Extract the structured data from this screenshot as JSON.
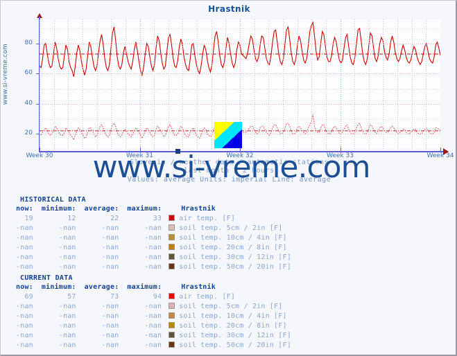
{
  "chart_data": {
    "type": "line",
    "title": "Hrastnik",
    "xlabel": "",
    "ylabel": "",
    "ylim": [
      10,
      96
    ],
    "yticks": [
      20,
      40,
      60,
      80
    ],
    "xticks": [
      "Week 30",
      "Week 31",
      "Week 32",
      "Week 33",
      "Week 34"
    ],
    "grid": true,
    "legend_position": "below-table",
    "subtitle_line1": "Slovenia / weather data / automatic stations",
    "subtitle_line2": "last month / 2 hours",
    "subtitle_line3": "Values: average  Units: imperial  Line: average",
    "watermark": "www.si-vreme.com",
    "side_label": "www.si-vreme.com",
    "series": [
      {
        "name": "air temp. [F] - current",
        "color": "#cc0000",
        "style": "solid",
        "average_line": 73,
        "min": 57,
        "max": 94,
        "now": 69,
        "values": [
          65,
          64,
          70,
          79,
          80,
          73,
          67,
          64,
          65,
          73,
          81,
          77,
          70,
          65,
          63,
          64,
          72,
          79,
          76,
          68,
          64,
          62,
          58,
          65,
          74,
          79,
          75,
          68,
          63,
          59,
          63,
          72,
          81,
          78,
          71,
          65,
          62,
          65,
          74,
          82,
          86,
          79,
          70,
          64,
          62,
          66,
          77,
          87,
          91,
          82,
          71,
          65,
          63,
          66,
          74,
          78,
          73,
          68,
          65,
          63,
          68,
          76,
          81,
          75,
          68,
          62,
          59,
          64,
          73,
          80,
          78,
          71,
          65,
          62,
          66,
          77,
          85,
          82,
          74,
          67,
          63,
          65,
          75,
          84,
          86,
          79,
          70,
          65,
          64,
          69,
          78,
          83,
          79,
          71,
          66,
          63,
          62,
          70,
          79,
          80,
          72,
          66,
          62,
          60,
          65,
          73,
          79,
          76,
          69,
          64,
          61,
          66,
          76,
          85,
          88,
          81,
          72,
          66,
          64,
          68,
          77,
          84,
          80,
          73,
          67,
          64,
          67,
          76,
          81,
          79,
          73,
          72,
          71,
          70,
          74,
          80,
          85,
          83,
          76,
          70,
          68,
          71,
          79,
          85,
          84,
          77,
          70,
          67,
          66,
          72,
          81,
          88,
          89,
          81,
          73,
          68,
          66,
          70,
          80,
          89,
          91,
          83,
          74,
          68,
          66,
          70,
          79,
          85,
          82,
          75,
          69,
          67,
          70,
          79,
          88,
          92,
          94,
          85,
          75,
          69,
          71,
          80,
          88,
          86,
          78,
          71,
          68,
          68,
          72,
          80,
          84,
          81,
          74,
          69,
          67,
          69,
          77,
          84,
          86,
          78,
          71,
          67,
          66,
          71,
          80,
          89,
          90,
          82,
          73,
          68,
          66,
          70,
          79,
          87,
          85,
          77,
          70,
          68,
          72,
          80,
          84,
          82,
          75,
          71,
          69,
          73,
          81,
          85,
          81,
          74,
          70,
          68,
          70,
          75,
          79,
          76,
          71,
          68,
          67,
          69,
          74,
          78,
          76,
          71,
          68,
          66,
          68,
          73,
          78,
          80,
          75,
          70,
          68,
          67,
          71,
          79,
          81,
          77,
          72
        ]
      },
      {
        "name": "air temp. [F] - historical",
        "color": "#e06666",
        "style": "dotted",
        "average_line": 22,
        "min": 12,
        "max": 33,
        "now": 19,
        "values": [
          20,
          19,
          21,
          23,
          24,
          22,
          20,
          19,
          20,
          22,
          25,
          24,
          22,
          20,
          19,
          19,
          21,
          24,
          23,
          21,
          19,
          18,
          16,
          19,
          22,
          24,
          23,
          21,
          19,
          17,
          18,
          21,
          24,
          24,
          22,
          20,
          18,
          19,
          22,
          25,
          26,
          24,
          21,
          19,
          18,
          19,
          23,
          26,
          27,
          25,
          21,
          19,
          18,
          19,
          22,
          23,
          22,
          20,
          19,
          18,
          20,
          22,
          24,
          23,
          21,
          19,
          17,
          19,
          22,
          24,
          23,
          21,
          19,
          18,
          19,
          23,
          25,
          24,
          22,
          20,
          18,
          19,
          22,
          25,
          26,
          24,
          21,
          19,
          19,
          20,
          23,
          25,
          24,
          21,
          19,
          18,
          18,
          21,
          23,
          24,
          22,
          19,
          18,
          17,
          19,
          22,
          24,
          23,
          20,
          19,
          18,
          19,
          23,
          25,
          26,
          24,
          21,
          19,
          19,
          20,
          23,
          25,
          24,
          22,
          20,
          19,
          20,
          23,
          24,
          23,
          22,
          21,
          21,
          21,
          22,
          24,
          25,
          25,
          23,
          21,
          20,
          21,
          24,
          25,
          25,
          23,
          21,
          20,
          19,
          21,
          24,
          26,
          26,
          24,
          22,
          20,
          20,
          21,
          24,
          27,
          27,
          25,
          22,
          20,
          20,
          21,
          24,
          25,
          24,
          22,
          21,
          20,
          21,
          24,
          26,
          28,
          33,
          25,
          22,
          21,
          21,
          24,
          26,
          26,
          23,
          21,
          20,
          20,
          22,
          24,
          25,
          24,
          22,
          20,
          20,
          21,
          23,
          25,
          26,
          23,
          21,
          20,
          20,
          21,
          24,
          26,
          27,
          24,
          22,
          20,
          20,
          21,
          24,
          26,
          25,
          23,
          21,
          20,
          22,
          24,
          25,
          24,
          22,
          21,
          21,
          22,
          24,
          25,
          24,
          22,
          21,
          20,
          21,
          22,
          23,
          23,
          21,
          20,
          20,
          21,
          22,
          23,
          23,
          21,
          20,
          20,
          20,
          22,
          23,
          24,
          22,
          21,
          20,
          20,
          21,
          24,
          24,
          23,
          22
        ]
      }
    ]
  },
  "historical": {
    "section_title": "HISTORICAL DATA",
    "headers": [
      "now:",
      "minimum:",
      "average:",
      "maximum:",
      "Hrastnik"
    ],
    "rows": [
      {
        "now": "19",
        "minimum": "12",
        "average": "22",
        "maximum": "33",
        "color": "#cc0c0c",
        "label": "air temp. [F]"
      },
      {
        "now": "-nan",
        "minimum": "-nan",
        "average": "-nan",
        "maximum": "-nan",
        "color": "#d9bcb8",
        "label": "soil temp. 5cm / 2in [F]"
      },
      {
        "now": "-nan",
        "minimum": "-nan",
        "average": "-nan",
        "maximum": "-nan",
        "color": "#c08a3e",
        "label": "soil temp. 10cm / 4in [F]"
      },
      {
        "now": "-nan",
        "minimum": "-nan",
        "average": "-nan",
        "maximum": "-nan",
        "color": "#b5831c",
        "label": "soil temp. 20cm / 8in [F]"
      },
      {
        "now": "-nan",
        "minimum": "-nan",
        "average": "-nan",
        "maximum": "-nan",
        "color": "#5e5638",
        "label": "soil temp. 30cm / 12in [F]"
      },
      {
        "now": "-nan",
        "minimum": "-nan",
        "average": "-nan",
        "maximum": "-nan",
        "color": "#6b3410",
        "label": "soil temp. 50cm / 20in [F]"
      }
    ]
  },
  "current": {
    "section_title": "CURRENT DATA",
    "headers": [
      "now:",
      "minimum:",
      "average:",
      "maximum:",
      "Hrastnik"
    ],
    "rows": [
      {
        "now": "69",
        "minimum": "57",
        "average": "73",
        "maximum": "94",
        "color": "#e60000",
        "label": "air temp. [F]"
      },
      {
        "now": "-nan",
        "minimum": "-nan",
        "average": "-nan",
        "maximum": "-nan",
        "color": "#d9b3b3",
        "label": "soil temp. 5cm / 2in [F]"
      },
      {
        "now": "-nan",
        "minimum": "-nan",
        "average": "-nan",
        "maximum": "-nan",
        "color": "#c08a3e",
        "label": "soil temp. 10cm / 4in [F]"
      },
      {
        "now": "-nan",
        "minimum": "-nan",
        "average": "-nan",
        "maximum": "-nan",
        "color": "#b8860b",
        "label": "soil temp. 20cm / 8in [F]"
      },
      {
        "now": "-nan",
        "minimum": "-nan",
        "average": "-nan",
        "maximum": "-nan",
        "color": "#5e5638",
        "label": "soil temp. 30cm / 12in [F]"
      },
      {
        "now": "-nan",
        "minimum": "-nan",
        "average": "-nan",
        "maximum": "-nan",
        "color": "#6b3410",
        "label": "soil temp. 50cm / 20in [F]"
      }
    ]
  }
}
